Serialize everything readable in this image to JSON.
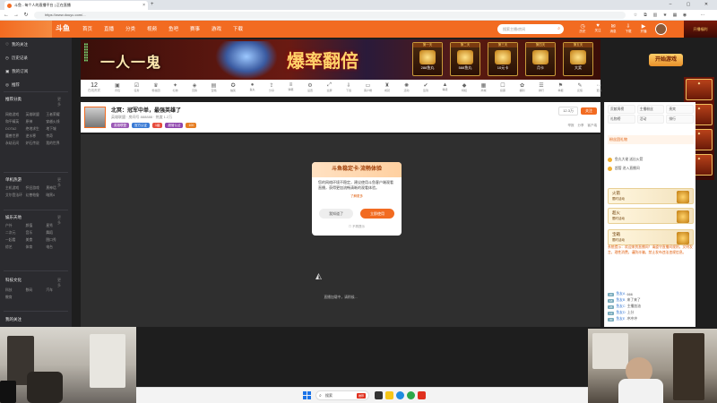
{
  "browser": {
    "tab_title": "斗鱼 - 每个人的直播平台 | 正在直播",
    "url": "https://www.douyu.com/..."
  },
  "header": {
    "logo": "斗鱼",
    "nav": [
      "首页",
      "直播",
      "分类",
      "视频",
      "鱼吧",
      "赛事",
      "游戏",
      "下载"
    ],
    "search_placeholder": "搜索主播/房间",
    "icons": [
      {
        "icon": "history-icon",
        "label": "历史"
      },
      {
        "icon": "follow-icon",
        "label": "关注"
      },
      {
        "icon": "message-icon",
        "label": "消息"
      },
      {
        "icon": "download-icon",
        "label": "下载"
      },
      {
        "icon": "live-icon",
        "label": "开播"
      }
    ],
    "right_ad": "开播福利"
  },
  "sidebar": {
    "top_items": [
      "我的关注",
      "历史记录",
      "我的订阅",
      "推荐"
    ],
    "sections": [
      {
        "title": "推荐分类",
        "more": "更多",
        "items": [
          "网络游戏",
          "英雄联盟",
          "王者荣耀",
          "和平精英",
          "原神",
          "穿越火线",
          "DOTA2",
          "绝地求生",
          "地下城",
          "魔兽世界",
          "逆水寒",
          "传奇",
          "永劫无间",
          "炉石传说",
          "我的世界"
        ]
      },
      {
        "title": "单机热游",
        "more": "更多",
        "items": [
          "主机游戏",
          "怀旧游戏",
          "黑神话",
          "艾尔登法环",
          "幻兽帕鲁",
          "暗黑4"
        ]
      },
      {
        "title": "娱乐天地",
        "more": "更多",
        "items": [
          "户外",
          "颜值",
          "星秀",
          "二次元",
          "音乐",
          "舞蹈",
          "一起看",
          "美食",
          "脱口秀",
          "综艺",
          "体育",
          "电台"
        ]
      },
      {
        "title": "科技文化",
        "more": "更多",
        "items": [
          "科技",
          "数码",
          "汽车",
          "教育"
        ]
      },
      {
        "title": "我的关注",
        "more": "",
        "items": []
      }
    ]
  },
  "banner": {
    "title_left": "一人一鬼",
    "title_center": "爆率翻倍",
    "prizes": [
      {
        "cap": "第一天",
        "label": "288鱼丸"
      },
      {
        "cap": "第二天",
        "label": "588鱼丸"
      },
      {
        "cap": "第三天",
        "label": "10元卡"
      },
      {
        "cap": "第四天",
        "label": "月卡"
      },
      {
        "cap": "第五天",
        "label": "大奖"
      }
    ],
    "cta": "开始游戏"
  },
  "toolbar": {
    "count_value": "12",
    "count_label": "在线贵宾",
    "items": [
      "背包",
      "任务",
      "粉丝团",
      "礼物",
      "竞猜",
      "宝箱",
      "抽奖",
      "鱼丸",
      "分享",
      "弹幕",
      "设置",
      "全屏",
      "下载",
      "客户端",
      "成就",
      "活动",
      "签到",
      "等级",
      "特权",
      "商城",
      "投票",
      "福利",
      "排行",
      "举报",
      "反馈",
      "更多"
    ]
  },
  "streamer": {
    "title": "北冥：冠军中单，最强英雄了",
    "meta": "英雄联盟 · 房间号 888888 · 热度 1.2万",
    "tags": [
      {
        "text": "英雄联盟",
        "color": "#9b59b6"
      },
      {
        "text": "官方认证",
        "color": "#3a7bd5"
      },
      {
        "text": "1级",
        "color": "#e74c3c"
      },
      {
        "text": "超管认证",
        "color": "#8e44ad"
      },
      {
        "text": "100",
        "color": "#e67e22"
      }
    ],
    "fans": "12.3万",
    "follow": "关注",
    "right_links": [
      "举报",
      "分享",
      "客户端"
    ]
  },
  "popup": {
    "title": "斗鱼稳定卡·流畅体验",
    "body": "您的网络环境不稳定，建议使用斗鱼客户端观看直播，获得更加流畅清晰的观看体验。",
    "link": "了解更多",
    "btn_cancel": "我知道了",
    "btn_ok": "立即使用",
    "foot": "不再提示"
  },
  "video": {
    "loading_text": "直播加载中，请稍候..."
  },
  "chat": {
    "tabs": [
      "贡献周榜",
      "主播粉丝",
      "贵宾"
    ],
    "tabs2": [
      "礼物榜",
      "活动",
      "排行"
    ],
    "gift_title": "粉丝团礼物",
    "ranks": [
      "鱼丸大佬 送出火箭",
      "超管 进入直播间"
    ],
    "cards": [
      {
        "title": "火箭",
        "sub": "限时活动"
      },
      {
        "title": "超火",
        "sub": "限时活动"
      },
      {
        "title": "宝箱",
        "sub": "限时活动"
      }
    ],
    "notice": "系统提示：欢迎来到直播间！请遵守直播间规则，文明发言，理性消费，谨防诈骗，禁止发布违法违规信息。",
    "messages": [
      {
        "lv": "20",
        "name": "鱼友A",
        "text": "666"
      },
      {
        "lv": "18",
        "name": "鱼友B",
        "text": "来了来了"
      },
      {
        "lv": "25",
        "name": "鱼友C",
        "text": "主播加油"
      },
      {
        "lv": "12",
        "name": "鱼友D",
        "text": "上分"
      },
      {
        "lv": "30",
        "name": "鱼友E",
        "text": "冲冲冲"
      },
      {
        "lv": "16",
        "name": "鱼友F",
        "text": "好强"
      }
    ]
  },
  "taskbar": {
    "search_label": "搜索",
    "search_badge": "推荐"
  }
}
